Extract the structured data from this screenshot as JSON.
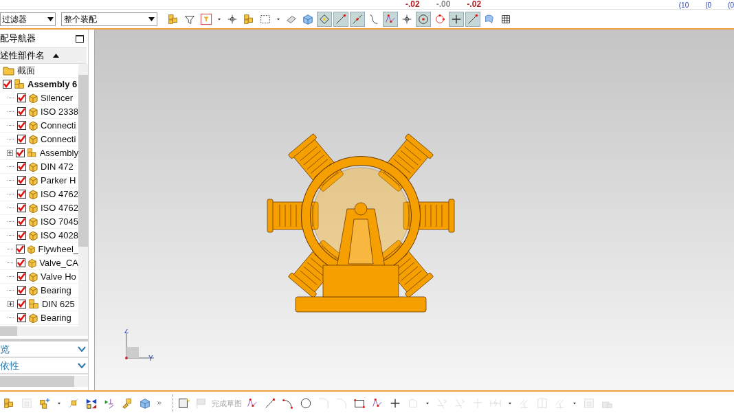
{
  "top_strip": {
    "readings": [
      {
        "text": "-.02",
        "kind": "red"
      },
      {
        "text": "-.00",
        "kind": "grey"
      },
      {
        "text": "-.02",
        "kind": "red"
      }
    ],
    "fractions": [
      "(10",
      "(0",
      "(0"
    ]
  },
  "selection_bar": {
    "type_filter": "过滤器",
    "scope": "整个装配",
    "tools": [
      {
        "kind": "assembly",
        "selected": false
      },
      {
        "kind": "filter",
        "selected": false
      },
      {
        "kind": "filter-box",
        "selected": false
      },
      {
        "kind": "caret",
        "selected": false
      },
      {
        "kind": "cross",
        "selected": false
      },
      {
        "kind": "assembly",
        "selected": false
      },
      {
        "kind": "select-box",
        "selected": false
      },
      {
        "kind": "caret",
        "selected": false
      },
      {
        "kind": "eraser",
        "selected": false
      },
      {
        "kind": "cube",
        "selected": false
      },
      {
        "kind": "snap",
        "selected": true
      },
      {
        "kind": "line-end",
        "selected": true
      },
      {
        "kind": "line-mid",
        "selected": true
      },
      {
        "kind": "curve",
        "selected": false
      },
      {
        "kind": "spline",
        "selected": true
      },
      {
        "kind": "cross",
        "selected": false
      },
      {
        "kind": "circle-center",
        "selected": true
      },
      {
        "kind": "circle-quad",
        "selected": false
      },
      {
        "kind": "plus",
        "selected": true
      },
      {
        "kind": "line-end",
        "selected": true
      },
      {
        "kind": "surface",
        "selected": false
      },
      {
        "kind": "grid",
        "selected": false
      }
    ]
  },
  "navigator": {
    "title": "配导航器",
    "column": "述性部件名",
    "tree": [
      {
        "label": "截面",
        "kind": "folder"
      },
      {
        "label": "Assembly 6",
        "kind": "assembly",
        "checked": true,
        "children": [
          {
            "label": "Silencer",
            "kind": "part",
            "checked": true
          },
          {
            "label": "ISO 2338",
            "kind": "part",
            "checked": true
          },
          {
            "label": "Connecti",
            "kind": "part",
            "checked": true
          },
          {
            "label": "Connecti",
            "kind": "part",
            "checked": true
          },
          {
            "label": "Assembly",
            "kind": "assembly",
            "checked": true,
            "expanded": false
          },
          {
            "label": "DIN 472",
            "kind": "part",
            "checked": true
          },
          {
            "label": "Parker H",
            "kind": "part",
            "checked": true
          },
          {
            "label": "ISO 4762",
            "kind": "part",
            "checked": true
          },
          {
            "label": "ISO 4762",
            "kind": "part",
            "checked": true
          },
          {
            "label": "ISO 7045",
            "kind": "part",
            "checked": true
          },
          {
            "label": "ISO 4028",
            "kind": "part",
            "checked": true
          },
          {
            "label": "Flywheel_",
            "kind": "part",
            "checked": true
          },
          {
            "label": "Valve_CA",
            "kind": "part",
            "checked": true
          },
          {
            "label": "Valve Ho",
            "kind": "part",
            "checked": true
          },
          {
            "label": "Bearing",
            "kind": "part",
            "checked": true
          },
          {
            "label": "DIN 625",
            "kind": "assembly",
            "checked": true,
            "expanded": false
          },
          {
            "label": "Bearing",
            "kind": "part",
            "checked": true
          }
        ]
      }
    ],
    "sections": [
      {
        "label": "览",
        "expanded": false
      },
      {
        "label": "依性",
        "expanded": false
      }
    ]
  },
  "viewport": {
    "axes": {
      "z": "Z",
      "y": "Y"
    }
  },
  "bottom_toolbar": {
    "tools": [
      {
        "kind": "assembly",
        "disabled": false
      },
      {
        "kind": "window",
        "disabled": true
      },
      {
        "kind": "add",
        "disabled": false
      },
      {
        "kind": "caret",
        "disabled": false
      },
      {
        "kind": "move",
        "disabled": false
      },
      {
        "kind": "mirror",
        "disabled": false
      },
      {
        "kind": "constraint",
        "disabled": false
      },
      {
        "kind": "hand",
        "disabled": false
      },
      {
        "kind": "cube",
        "disabled": false
      },
      {
        "kind": "more",
        "disabled": false
      }
    ],
    "sketch_tools": [
      {
        "kind": "sketch",
        "disabled": false
      },
      {
        "kind": "flag",
        "disabled": true
      }
    ],
    "finish_label": {
      "text": "完成草图",
      "disabled": true
    },
    "curve_tools": [
      {
        "kind": "spline",
        "disabled": false
      },
      {
        "kind": "line-end",
        "disabled": false
      },
      {
        "kind": "arc",
        "disabled": false
      },
      {
        "kind": "circle",
        "disabled": false
      },
      {
        "kind": "fillet",
        "disabled": true
      },
      {
        "kind": "chamfer",
        "disabled": true
      },
      {
        "kind": "rect",
        "disabled": false
      },
      {
        "kind": "spline",
        "disabled": false
      },
      {
        "kind": "plus",
        "disabled": false
      },
      {
        "kind": "profile",
        "disabled": true
      },
      {
        "kind": "caret",
        "disabled": false
      },
      {
        "kind": "trim",
        "disabled": true
      },
      {
        "kind": "trim",
        "disabled": true
      },
      {
        "kind": "extend",
        "disabled": true
      },
      {
        "kind": "dimension",
        "disabled": true
      },
      {
        "kind": "caret",
        "disabled": false
      },
      {
        "kind": "parallel",
        "disabled": true
      },
      {
        "kind": "symmetric",
        "disabled": true
      },
      {
        "kind": "parallel",
        "disabled": true
      },
      {
        "kind": "caret",
        "disabled": false
      },
      {
        "kind": "window",
        "disabled": true
      },
      {
        "kind": "lock",
        "disabled": true
      }
    ]
  }
}
